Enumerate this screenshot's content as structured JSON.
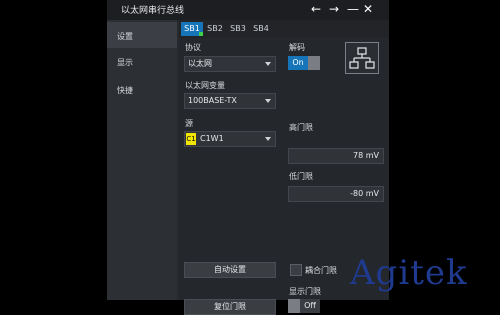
{
  "window": {
    "title": "以太网串行总线",
    "buttons": [
      "←",
      "→",
      "—",
      "✕"
    ]
  },
  "nav": {
    "items": [
      {
        "label": "设置",
        "active": true
      },
      {
        "label": "显示",
        "active": false
      },
      {
        "label": "快捷",
        "active": false
      }
    ]
  },
  "tabs": [
    {
      "label": "SB1",
      "active": true
    },
    {
      "label": "SB2",
      "active": false
    },
    {
      "label": "SB3",
      "active": false
    },
    {
      "label": "SB4",
      "active": false
    }
  ],
  "form": {
    "protocol_label": "协议",
    "protocol_value": "以太网",
    "decode_label": "解码",
    "decode_state": "On",
    "variant_label": "以太网变量",
    "variant_value": "100BASE-TX",
    "source_label": "源",
    "source_chip": "C1",
    "source_value": "C1W1",
    "high_threshold_label": "高门限",
    "high_threshold_value": "78 mV",
    "low_threshold_label": "低门限",
    "low_threshold_value": "-80 mV",
    "auto_setup_label": "自动设置",
    "couple_threshold_label": "耦合门限",
    "show_threshold_label": "显示门限",
    "show_threshold_state": "Off",
    "reset_threshold_label": "复位门限"
  },
  "watermark": "Agitek",
  "colors": {
    "accent": "#1675b9",
    "source_chip": "#f2e600",
    "indicator": "#3fd14b"
  },
  "icons": {
    "network": "network-topology-icon"
  }
}
